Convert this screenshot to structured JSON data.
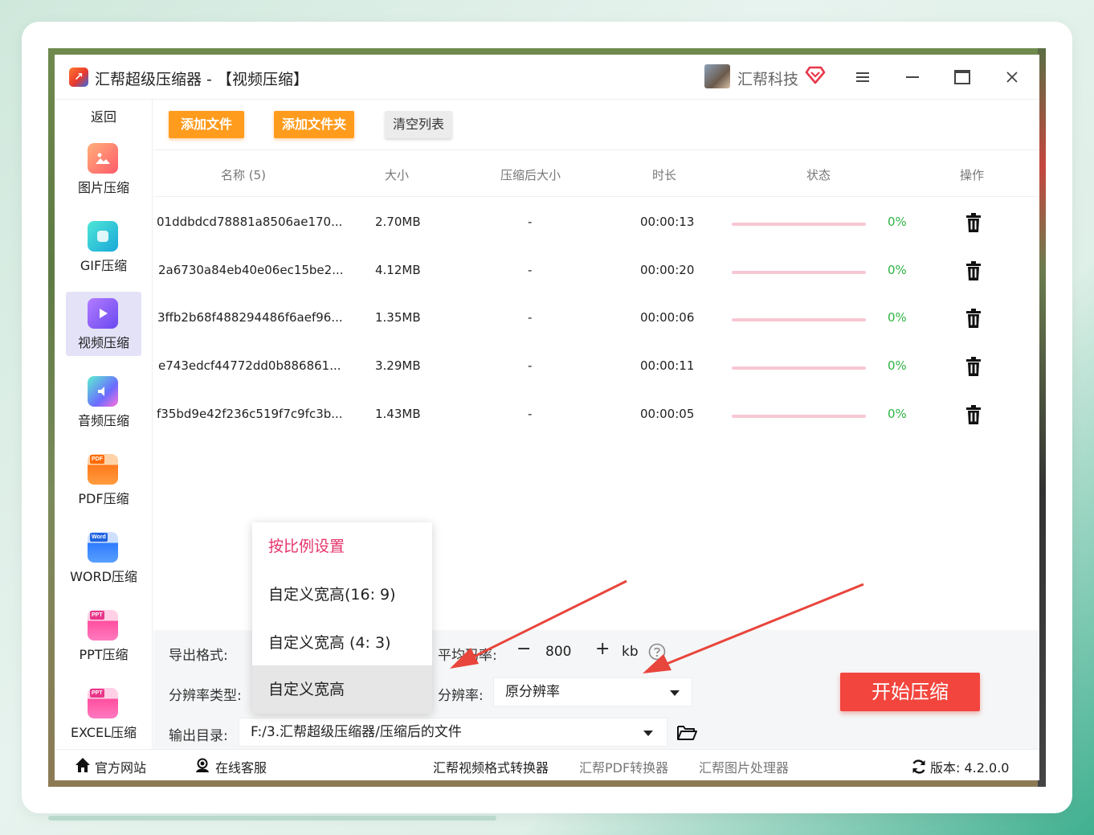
{
  "window": {
    "app_name": "汇帮超级压缩器",
    "title_suffix": " - 【视频压缩】",
    "user_name": "汇帮科技"
  },
  "sidebar": {
    "back_label": "返回",
    "items": [
      {
        "label": "图片压缩",
        "icon": "image-icon",
        "color": "#ff6b5a"
      },
      {
        "label": "GIF压缩",
        "icon": "gif-icon",
        "color": "#22c3d9"
      },
      {
        "label": "视频压缩",
        "icon": "video-icon",
        "color": "#8c5cf0",
        "active": true
      },
      {
        "label": "音频压缩",
        "icon": "audio-icon",
        "color": "#5aa0ff"
      },
      {
        "label": "PDF压缩",
        "icon": "pdf-icon",
        "color": "#ff8a2a",
        "tag": "PDF"
      },
      {
        "label": "WORD压缩",
        "icon": "word-icon",
        "color": "#3d8bff",
        "tag": "Word"
      },
      {
        "label": "PPT压缩",
        "icon": "ppt-icon",
        "color": "#ff5fa8",
        "tag": "PPT"
      },
      {
        "label": "EXCEL压缩",
        "icon": "excel-icon",
        "color": "#ff5fa8",
        "tag": "PPT"
      }
    ]
  },
  "toolbar": {
    "add_file": "添加文件",
    "add_folder": "添加文件夹",
    "clear_list": "清空列表"
  },
  "table": {
    "headers": {
      "name": "名称 (5)",
      "size": "大小",
      "compressed_size": "压缩后大小",
      "duration": "时长",
      "status": "状态",
      "action": "操作"
    },
    "rows": [
      {
        "name": "01ddbdcd78881a8506ae170...",
        "size": "2.70MB",
        "compressed": "-",
        "duration": "00:00:13",
        "progress": 0,
        "percent": "0%"
      },
      {
        "name": "2a6730a84eb40e06ec15be2...",
        "size": "4.12MB",
        "compressed": "-",
        "duration": "00:00:20",
        "progress": 0,
        "percent": "0%"
      },
      {
        "name": "3ffb2b68f488294486f6aef96...",
        "size": "1.35MB",
        "compressed": "-",
        "duration": "00:00:06",
        "progress": 0,
        "percent": "0%"
      },
      {
        "name": "e743edcf44772dd0b886861...",
        "size": "3.29MB",
        "compressed": "-",
        "duration": "00:00:11",
        "progress": 0,
        "percent": "0%"
      },
      {
        "name": "f35bd9e42f236c519f7c9fc3b...",
        "size": "1.43MB",
        "compressed": "-",
        "duration": "00:00:05",
        "progress": 0,
        "percent": "0%"
      }
    ]
  },
  "settings": {
    "export_format_label": "导出格式:",
    "bitrate_label": "平均码率:",
    "bitrate_minus": "−",
    "bitrate_value": "800",
    "bitrate_plus": "+",
    "bitrate_unit": "kb",
    "resolution_type_label": "分辨率类型:",
    "resolution_label": "分辨率:",
    "resolution_value": "原分辨率",
    "output_dir_label": "输出目录:",
    "output_dir_value": "F:/3.汇帮超级压缩器/压缩后的文件",
    "start_button": "开始压缩"
  },
  "dropdown": {
    "items": [
      {
        "label": "按比例设置",
        "type": "header"
      },
      {
        "label": "自定义宽高(16: 9)"
      },
      {
        "label": "自定义宽高 (4: 3)"
      },
      {
        "label": "自定义宽高",
        "selected": true
      }
    ]
  },
  "footer": {
    "official_site": "官方网站",
    "online_service": "在线客服",
    "link_video_converter": "汇帮视频格式转换器",
    "link_pdf_converter": "汇帮PDF转换器",
    "link_image_processor": "汇帮图片处理器",
    "version_label": "版本: 4.2.0.0"
  },
  "colors": {
    "accent_orange": "#ff9c1e",
    "start_red": "#f2453d",
    "progress_track": "#f7c7d3",
    "percent_green": "#2fb344",
    "dropdown_header": "#e5336b",
    "annotation_arrow": "#e8453c"
  }
}
